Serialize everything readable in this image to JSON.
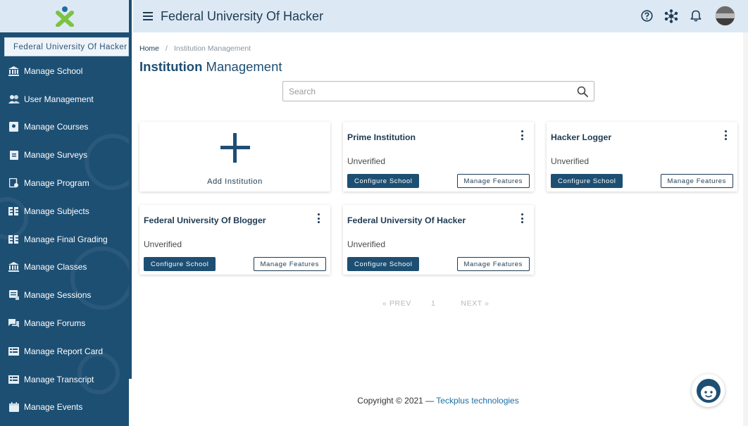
{
  "app": {
    "title": "Federal University Of Hacker"
  },
  "sidebar": {
    "school_selector": "Federal University Of Hacker",
    "items": [
      {
        "label": "Manage School",
        "icon": "institution-icon"
      },
      {
        "label": "User Management",
        "icon": "users-icon"
      },
      {
        "label": "Manage Courses",
        "icon": "course-icon"
      },
      {
        "label": "Manage Surveys",
        "icon": "clipboard-icon"
      },
      {
        "label": "Manage Program",
        "icon": "program-icon"
      },
      {
        "label": "Manage Subjects",
        "icon": "subjects-icon"
      },
      {
        "label": "Manage Final Grading",
        "icon": "grading-icon"
      },
      {
        "label": "Manage Classes",
        "icon": "classes-icon"
      },
      {
        "label": "Manage Sessions",
        "icon": "sessions-icon"
      },
      {
        "label": "Manage Forums",
        "icon": "forums-icon"
      },
      {
        "label": "Manage Report Card",
        "icon": "report-card-icon"
      },
      {
        "label": "Manage Transcript",
        "icon": "transcript-icon"
      },
      {
        "label": "Manage Events",
        "icon": "calendar-icon"
      }
    ]
  },
  "breadcrumb": {
    "home": "Home",
    "separator": "/",
    "current": "Institution Management"
  },
  "page_title": {
    "bold": "Institution",
    "rest": " Management"
  },
  "search": {
    "placeholder": "Search",
    "value": ""
  },
  "add_card": {
    "label": "Add Institution"
  },
  "cards": [
    {
      "title": "Prime Institution",
      "status": "Unverified",
      "configure_label": "Configure School",
      "features_label": "Manage Features"
    },
    {
      "title": "Hacker Logger",
      "status": "Unverified",
      "configure_label": "Configure School",
      "features_label": "Manage Features"
    },
    {
      "title": "Federal University Of Blogger",
      "status": "Unverified",
      "configure_label": "Configure School",
      "features_label": "Manage Features"
    },
    {
      "title": "Federal University Of Hacker",
      "status": "Unverified",
      "configure_label": "Configure School",
      "features_label": "Manage Features"
    }
  ],
  "pagination": {
    "prev": "« PREV",
    "page": "1",
    "next": "NEXT »"
  },
  "footer": {
    "copyright": "Copyright © 2021 — ",
    "brand": "Teckplus technologies"
  },
  "colors": {
    "primary": "#1d4f73",
    "header_bg": "#dce9f4",
    "logo_green": "#7cc243",
    "logo_blue": "#1d6fa5"
  }
}
